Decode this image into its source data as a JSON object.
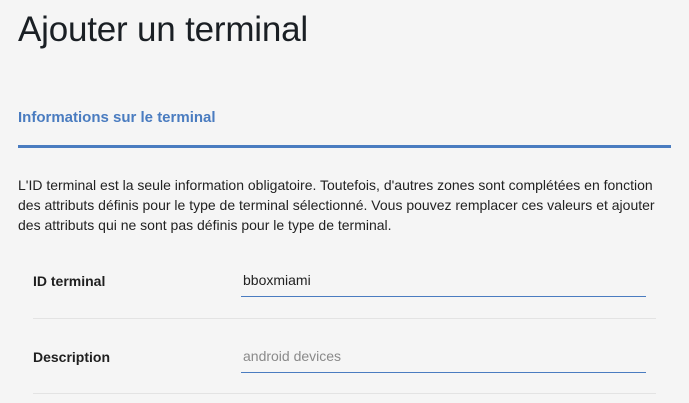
{
  "page": {
    "title": "Ajouter un terminal"
  },
  "section": {
    "heading": "Informations sur le terminal",
    "intro": "L'ID terminal est la seule information obligatoire. Toutefois, d'autres zones sont complétées en fonction des attributs définis pour le type de terminal sélectionné. Vous pouvez remplacer ces valeurs et ajouter des attributs qui ne sont pas définis pour le type de terminal.",
    "accent_color": "#4a7cc0"
  },
  "form": {
    "terminal_id": {
      "label": "ID terminal",
      "value": "bboxmiami"
    },
    "description": {
      "label": "Description",
      "value": "",
      "placeholder": "android devices"
    }
  }
}
